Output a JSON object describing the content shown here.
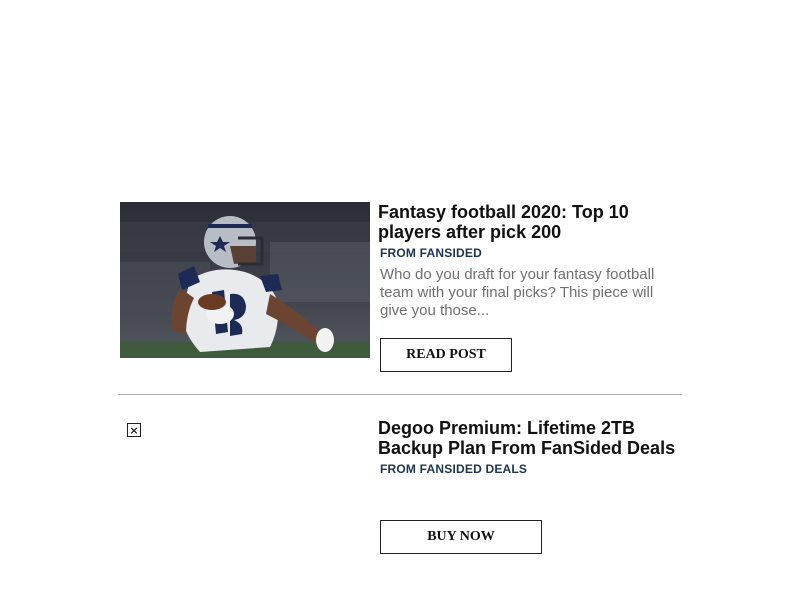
{
  "cards": [
    {
      "title": "Fantasy football 2020: Top 10 players after pick 200",
      "source": "FROM FANSIDED",
      "description": "Who do you draft for your fantasy football team with your final picks? This piece will give you those...",
      "cta_label": "READ POST",
      "image_icon": "football-player-photo"
    },
    {
      "title": "Degoo Premium: Lifetime 2TB Backup Plan From FanSided Deals",
      "source": "FROM FANSIDED DEALS",
      "cta_label": "BUY NOW",
      "image_icon": "broken-image-icon",
      "broken_image_glyph": "×"
    }
  ],
  "colors": {
    "source_text": "#20364e",
    "description_text": "#707070",
    "divider": "#b5b5b5"
  }
}
